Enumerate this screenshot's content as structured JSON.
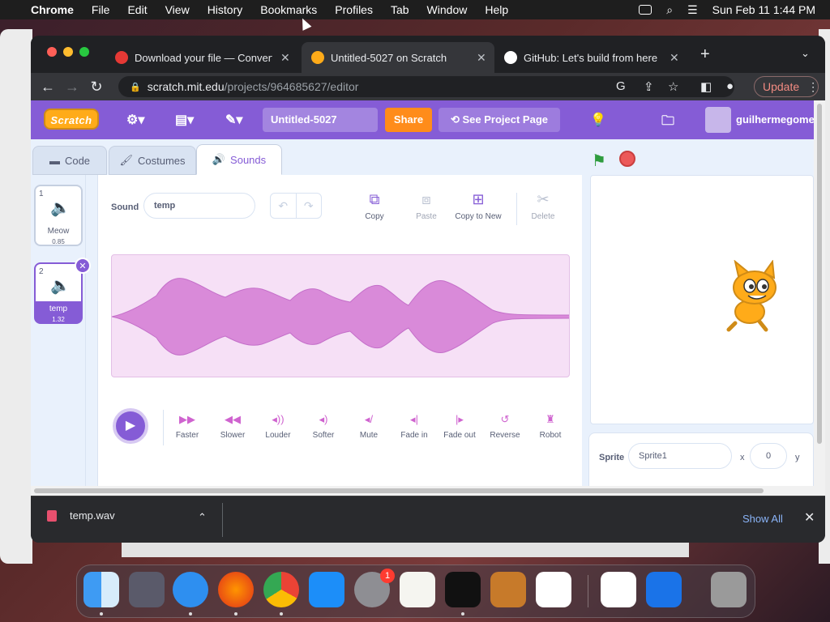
{
  "menubar": {
    "app": "Chrome",
    "items": [
      "File",
      "Edit",
      "View",
      "History",
      "Bookmarks",
      "Profiles",
      "Tab",
      "Window",
      "Help"
    ],
    "datetime": "Sun Feb 11  1:44 PM"
  },
  "tabs": [
    {
      "title": "Download your file — Convertio",
      "icon_color": "#e53935"
    },
    {
      "title": "Untitled-5027 on Scratch",
      "icon_color": "#ffab19"
    },
    {
      "title": "GitHub: Let's build from here ·",
      "icon_color": "#ffffff"
    }
  ],
  "address": {
    "domain": "scratch.mit.edu",
    "path": "/projects/964685627/editor"
  },
  "update_label": "Update",
  "scratch": {
    "logo": "Scratch",
    "project_title": "Untitled-5027",
    "share": "Share",
    "see_project": "See Project Page",
    "username": "guilhermegomes",
    "tabs": {
      "code": "Code",
      "costumes": "Costumes",
      "sounds": "Sounds"
    },
    "sounds": [
      {
        "num": "1",
        "name": "Meow",
        "duration": "0.85"
      },
      {
        "num": "2",
        "name": "temp",
        "duration": "1.32"
      }
    ],
    "editor": {
      "sound_label": "Sound",
      "sound_name": "temp",
      "tools": {
        "copy": "Copy",
        "paste": "Paste",
        "copy_to_new": "Copy to New",
        "delete": "Delete"
      },
      "effects": [
        "Faster",
        "Slower",
        "Louder",
        "Softer",
        "Mute",
        "Fade in",
        "Fade out",
        "Reverse",
        "Robot"
      ]
    },
    "sprite": {
      "label": "Sprite",
      "name": "Sprite1",
      "x_label": "x",
      "x": "0",
      "y_label": "y"
    }
  },
  "downloads": {
    "file": "temp.wav",
    "show_all": "Show All"
  },
  "dock": {
    "badge": "1"
  }
}
